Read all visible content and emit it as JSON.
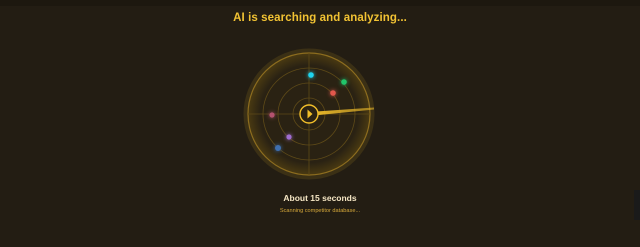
{
  "header": {
    "title": "AI is searching and analyzing..."
  },
  "radar": {
    "accent_color": "#f0bd2a",
    "blips": [
      {
        "name": "blip-cyan",
        "color": "#1fd3ee"
      },
      {
        "name": "blip-green",
        "color": "#21c56a"
      },
      {
        "name": "blip-red",
        "color": "#e2574c"
      },
      {
        "name": "blip-pink",
        "color": "#b4526f"
      },
      {
        "name": "blip-purple",
        "color": "#a06dd0"
      },
      {
        "name": "blip-blue",
        "color": "#3f6fae"
      }
    ]
  },
  "status": {
    "eta": "About 15 seconds",
    "message": "Scanning competitor database..."
  }
}
